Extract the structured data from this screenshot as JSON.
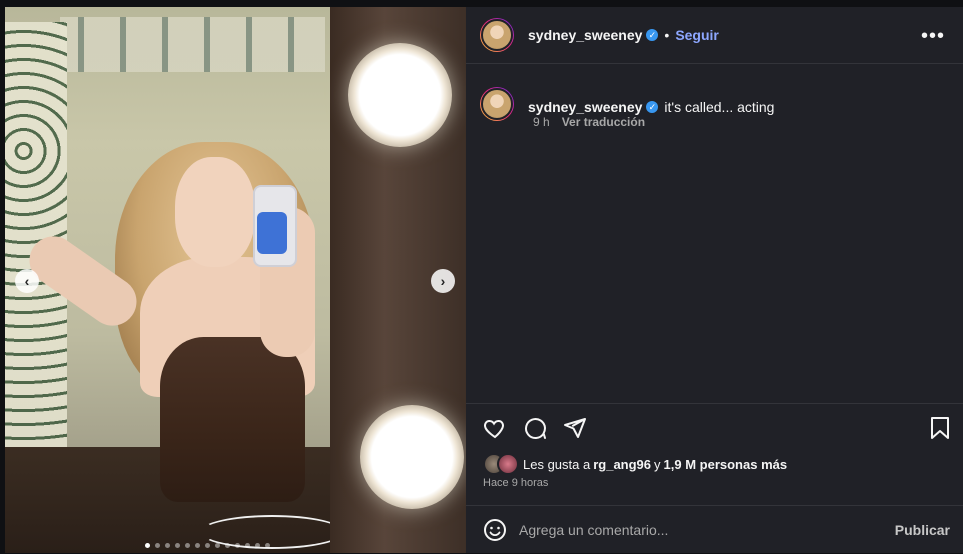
{
  "post": {
    "username": "sydney_sweeney",
    "separator": "•",
    "follow_label": "Seguir",
    "more_label": "•••",
    "caption": "it's called... acting",
    "time_ago": "9 h",
    "translate_label": "Ver traducción",
    "likes_text": "Les gusta a ",
    "likes_user": "rg_ang96",
    "likes_rest": " y ",
    "likes_count": "1,9 M personas más",
    "posted": "Hace 9 horas",
    "comment_placeholder": "Agrega un comentario...",
    "publish_label": "Publicar"
  },
  "carousel": {
    "total_dots": 13,
    "active_index": 0
  },
  "colors": {
    "panel": "#202127",
    "follow": "#8da7ff",
    "verified": "#3897f0"
  },
  "icons": [
    "chevron-left-icon",
    "chevron-right-icon",
    "heart-icon",
    "comment-icon",
    "share-icon",
    "bookmark-icon",
    "emoji-icon",
    "verified-icon"
  ]
}
